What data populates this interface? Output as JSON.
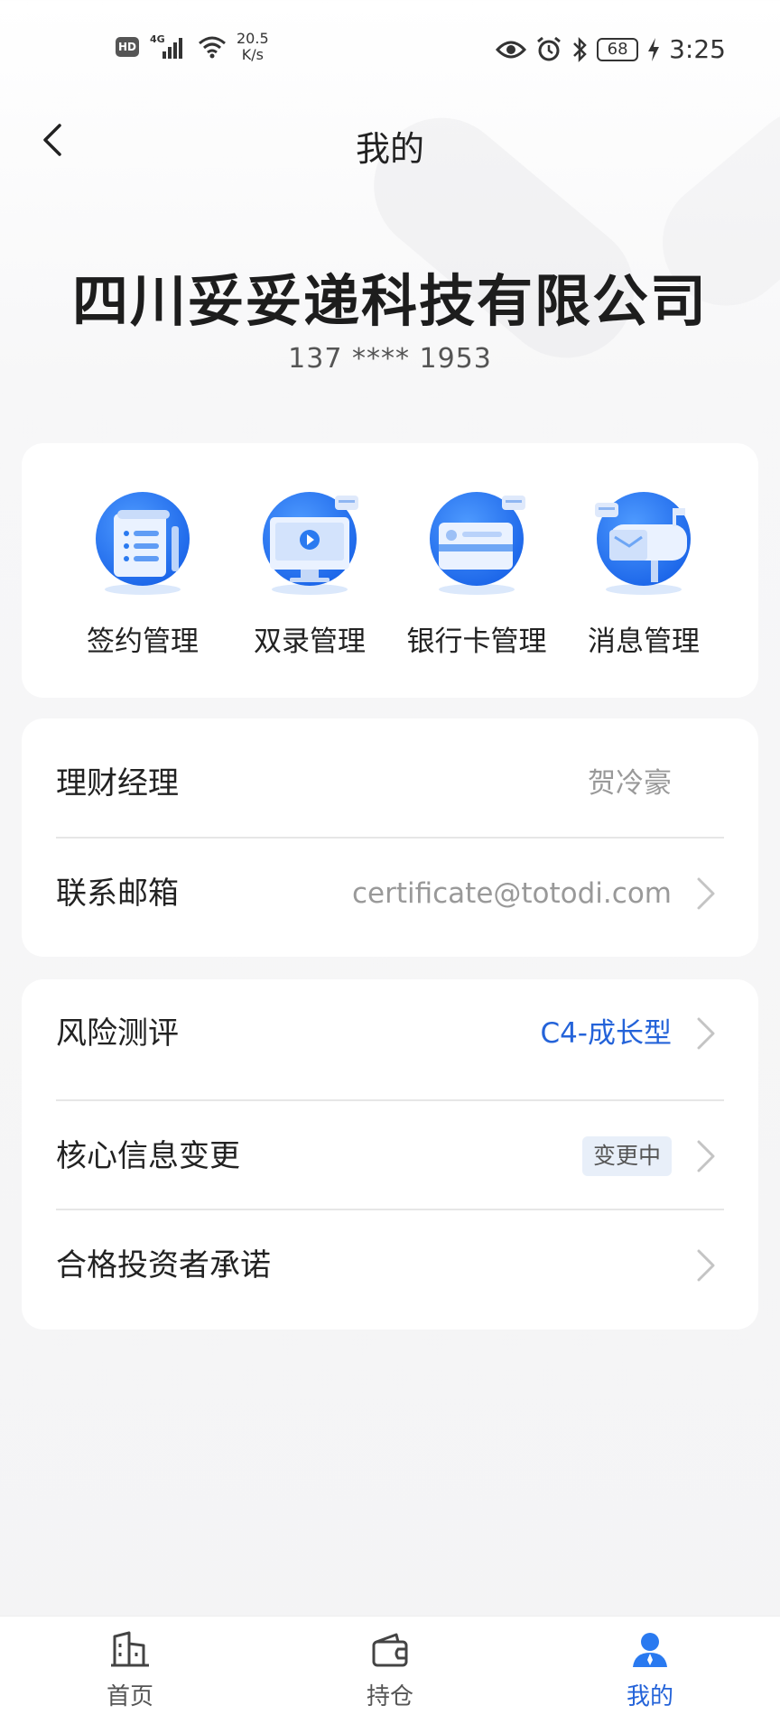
{
  "status_bar": {
    "hd": "HD",
    "network": "4G",
    "speed_value": "20.5",
    "speed_unit": "K/s",
    "battery": "68",
    "time": "3:25"
  },
  "header": {
    "title": "我的"
  },
  "profile": {
    "company": "四川妥妥递科技有限公司",
    "phone": "137 **** 1953"
  },
  "quick_actions": [
    {
      "label": "签约管理",
      "icon": "contract-icon"
    },
    {
      "label": "双录管理",
      "icon": "video-record-icon"
    },
    {
      "label": "银行卡管理",
      "icon": "bank-card-icon"
    },
    {
      "label": "消息管理",
      "icon": "mailbox-icon"
    }
  ],
  "info": {
    "manager_label": "理财经理",
    "manager_value": "贺冷豪",
    "email_label": "联系邮箱",
    "email_value": "certificate@totodi.com"
  },
  "more": {
    "risk_label": "风险测评",
    "risk_value": "C4-成长型",
    "core_label": "核心信息变更",
    "core_badge": "变更中",
    "investor_label": "合格投资者承诺"
  },
  "bottom_nav": [
    {
      "label": "首页",
      "icon": "building-icon"
    },
    {
      "label": "持仓",
      "icon": "wallet-icon"
    },
    {
      "label": "我的",
      "icon": "user-icon",
      "active": true
    }
  ],
  "colors": {
    "accent": "#2463d9",
    "icon_blue": "#2a7af0"
  }
}
